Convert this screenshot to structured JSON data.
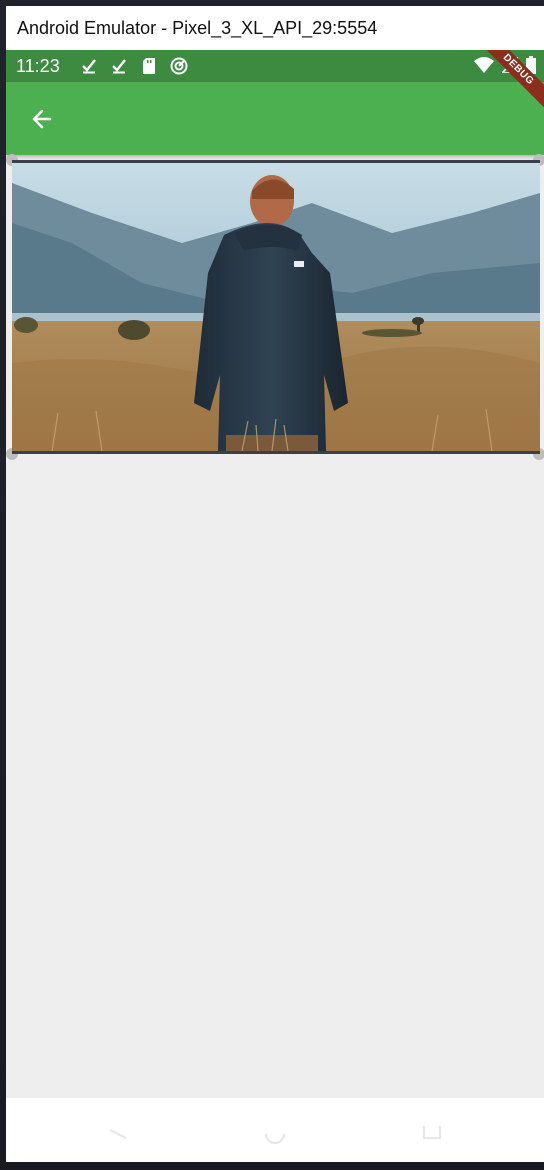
{
  "window": {
    "title": "Android Emulator - Pixel_3_XL_API_29:5554"
  },
  "status_bar": {
    "time": "11:23",
    "left_icons": [
      "check-download-icon",
      "check-download-icon",
      "sd-card-icon",
      "sync-icon"
    ],
    "right_icons": [
      "wifi-icon",
      "signal-icon",
      "battery-icon"
    ],
    "color": "#3d8b40"
  },
  "debug_banner": {
    "label": "DEBUG"
  },
  "app_bar": {
    "color": "#4caf50",
    "back_icon": "arrow-back-icon"
  },
  "image": {
    "description_icon": "photo-person-in-field"
  },
  "nav_bar": {
    "buttons": [
      "back-triangle-icon",
      "home-circle-icon",
      "recents-square-icon"
    ]
  }
}
